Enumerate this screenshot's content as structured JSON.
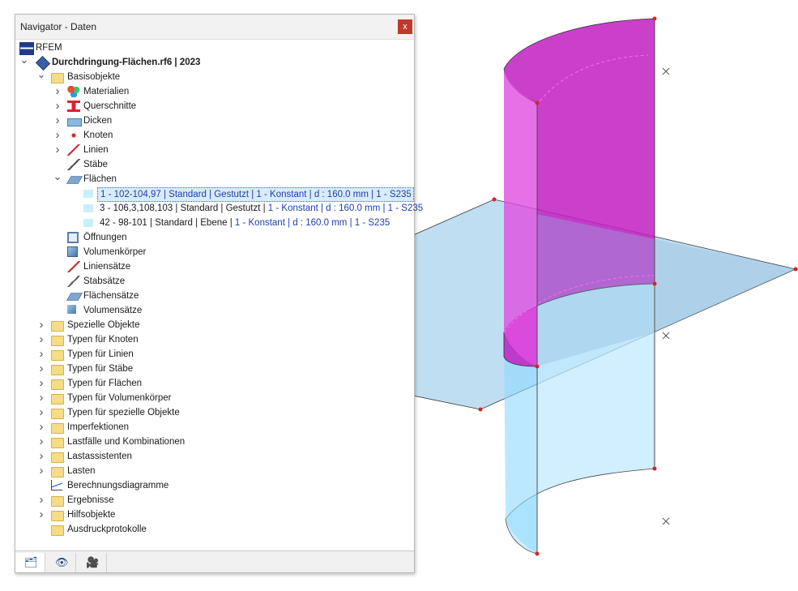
{
  "panel": {
    "title": "Navigator - Daten",
    "close_label": "x"
  },
  "tree": [
    {
      "label": "RFEM",
      "icon": "rfem-flag-icon",
      "arrow": "",
      "bold": false
    },
    {
      "label": "Durchdringung-Flächen.rf6 | 2023",
      "icon": "model-file-icon",
      "arrow": "v",
      "bold": true
    },
    {
      "label": "Basisobjekte",
      "icon": "folder-icon",
      "arrow": "v"
    },
    {
      "label": "Materialien",
      "icon": "materials-icon",
      "arrow": ">"
    },
    {
      "label": "Querschnitte",
      "icon": "cross-section-icon",
      "arrow": ">"
    },
    {
      "label": "Dicken",
      "icon": "thickness-icon",
      "arrow": ">"
    },
    {
      "label": "Knoten",
      "icon": "node-icon",
      "arrow": ">"
    },
    {
      "label": "Linien",
      "icon": "line-icon",
      "arrow": ">"
    },
    {
      "label": "Stäbe",
      "icon": "member-icon",
      "arrow": ""
    },
    {
      "label": "Flächen",
      "icon": "surface-icon",
      "arrow": "v"
    },
    {
      "label_a": "1 - 102-104,97 | Standard | Gestutzt | 1 - Konstant | d : 160.0 mm | 1 - S235",
      "icon": "surface-item-icon",
      "selected": true
    },
    {
      "label_a": "3 - 106,3,108,103 | Standard | Gestutzt | ",
      "label_b": "1 - Konstant | d : 160.0 mm | 1 - S235",
      "icon": "surface-item-icon"
    },
    {
      "label_a": "42 - 98-101 | Standard | Ebene | ",
      "label_b": "1 - Konstant | d : 160.0 mm | 1 - S235",
      "icon": "surface-item-icon"
    },
    {
      "label": "Öffnungen",
      "icon": "opening-icon",
      "arrow": ""
    },
    {
      "label": "Volumenkörper",
      "icon": "solid-icon",
      "arrow": ""
    },
    {
      "label": "Liniensätze",
      "icon": "line-set-icon",
      "arrow": ""
    },
    {
      "label": "Stabsätze",
      "icon": "member-set-icon",
      "arrow": ""
    },
    {
      "label": "Flächensätze",
      "icon": "surface-set-icon",
      "arrow": ""
    },
    {
      "label": "Volumensätze",
      "icon": "solid-set-icon",
      "arrow": ""
    },
    {
      "label": "Spezielle Objekte",
      "icon": "folder-icon",
      "arrow": ">"
    },
    {
      "label": "Typen für Knoten",
      "icon": "folder-icon",
      "arrow": ">"
    },
    {
      "label": "Typen für Linien",
      "icon": "folder-icon",
      "arrow": ">"
    },
    {
      "label": "Typen für Stäbe",
      "icon": "folder-icon",
      "arrow": ">"
    },
    {
      "label": "Typen für Flächen",
      "icon": "folder-icon",
      "arrow": ">"
    },
    {
      "label": "Typen für Volumenkörper",
      "icon": "folder-icon",
      "arrow": ">"
    },
    {
      "label": "Typen für spezielle Objekte",
      "icon": "folder-icon",
      "arrow": ">"
    },
    {
      "label": "Imperfektionen",
      "icon": "folder-icon",
      "arrow": ">"
    },
    {
      "label": "Lastfälle und Kombinationen",
      "icon": "folder-icon",
      "arrow": ">"
    },
    {
      "label": "Lastassistenten",
      "icon": "folder-icon",
      "arrow": ">"
    },
    {
      "label": "Lasten",
      "icon": "folder-icon",
      "arrow": ">"
    },
    {
      "label": "Berechnungsdiagramme",
      "icon": "diagram-icon",
      "arrow": ""
    },
    {
      "label": "Ergebnisse",
      "icon": "folder-icon",
      "arrow": ">"
    },
    {
      "label": "Hilfsobjekte",
      "icon": "folder-icon",
      "arrow": ">"
    },
    {
      "label": "Ausdruckprotokolle",
      "icon": "folder-icon",
      "arrow": ""
    }
  ],
  "tabs": [
    {
      "icon": "data-navigator-icon",
      "active": true
    },
    {
      "icon": "view-eye-icon",
      "active": false
    },
    {
      "icon": "camera-icon",
      "active": false
    }
  ],
  "colors": {
    "surface_magenta": "#cc22cc",
    "surface_lightblue": "#a8d4ee",
    "node_red": "#e02020",
    "selection_blue": "#d9ebff"
  }
}
